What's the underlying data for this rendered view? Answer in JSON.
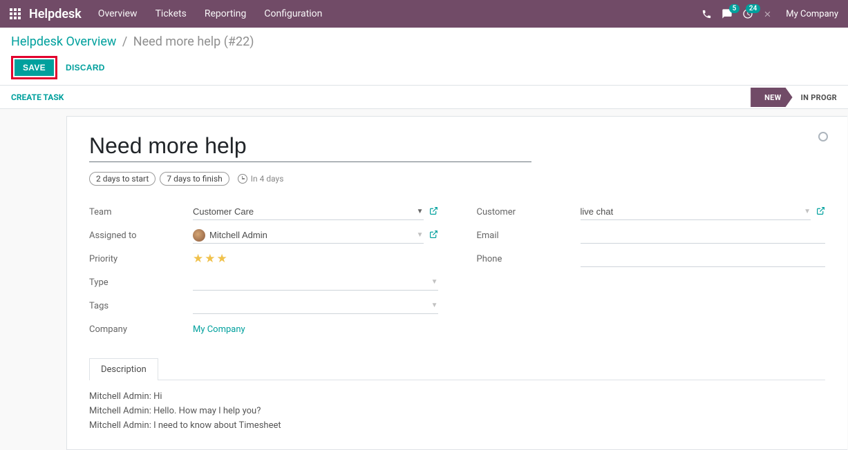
{
  "navbar": {
    "brand": "Helpdesk",
    "menu": [
      "Overview",
      "Tickets",
      "Reporting",
      "Configuration"
    ],
    "chat_badge": "5",
    "activity_badge": "24",
    "company": "My Company"
  },
  "breadcrumb": {
    "parent": "Helpdesk Overview",
    "current": "Need more help (#22)"
  },
  "buttons": {
    "save": "SAVE",
    "discard": "DISCARD",
    "create_task": "CREATE TASK"
  },
  "stages": {
    "active": "NEW",
    "next": "IN PROGR"
  },
  "record": {
    "title": "Need more help",
    "sla_start": "2 days to start",
    "sla_finish": "7 days to finish",
    "sla_in": "In 4 days"
  },
  "fields": {
    "team_label": "Team",
    "team_value": "Customer Care",
    "assigned_label": "Assigned to",
    "assigned_value": "Mitchell Admin",
    "priority_label": "Priority",
    "type_label": "Type",
    "type_value": "",
    "tags_label": "Tags",
    "tags_value": "",
    "company_label": "Company",
    "company_value": "My Company",
    "customer_label": "Customer",
    "customer_value": "live chat",
    "email_label": "Email",
    "email_value": "",
    "phone_label": "Phone",
    "phone_value": ""
  },
  "tabs": {
    "description": "Description"
  },
  "description_lines": [
    "Mitchell Admin: Hi",
    "Mitchell Admin: Hello. How may I help you?",
    "Mitchell Admin: I need to know about Timesheet"
  ]
}
